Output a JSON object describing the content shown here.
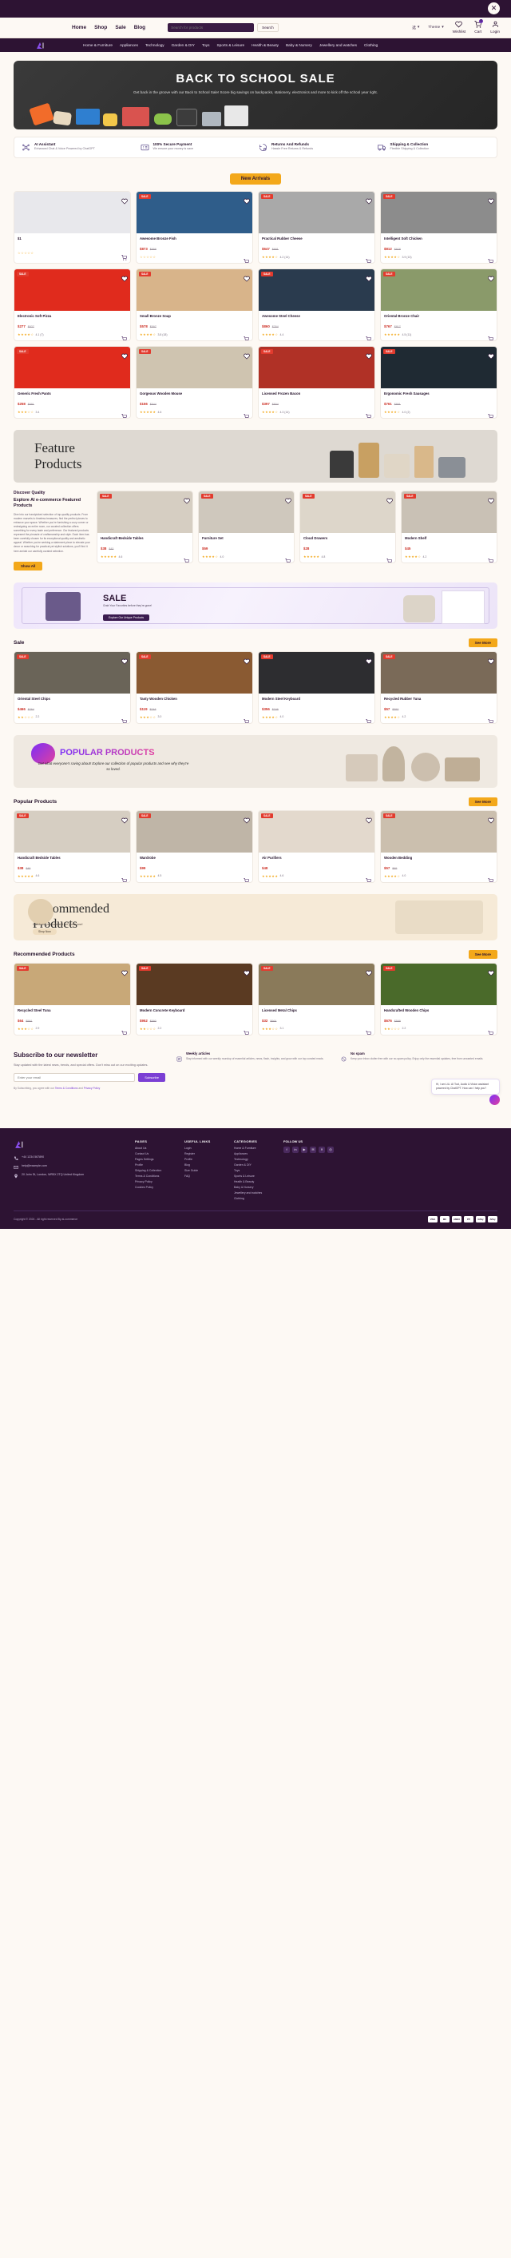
{
  "topbar": {
    "close_label": "✕"
  },
  "nav": {
    "links": [
      "Home",
      "Shop",
      "Sale",
      "Blog"
    ],
    "search_placeholder": "Search for products",
    "search_button": "Search",
    "language": "选",
    "theme": "Theme",
    "wishlist": "Wishlist",
    "cart": "Cart",
    "cart_count": "0",
    "login": "Login"
  },
  "categories": [
    "Home & Furniture",
    "Appliances",
    "Technology",
    "Garden & DIY",
    "Toys",
    "Sports & Leisure",
    "Health & Beauty",
    "Baby & Nursery",
    "Jewellery and watches",
    "Clothing"
  ],
  "hero": {
    "title": "BACK TO SCHOOL SALE",
    "subtitle": "Get back in the groove with our Back to School Sale! Score big savings on backpacks, stationery, electronics and more to kick off the school year right."
  },
  "features": [
    {
      "icon": "ai-assistant-icon",
      "title": "AI Assistant",
      "desc": "Enhanced Chat & Voice Powered by ChatGPT"
    },
    {
      "icon": "secure-payment-icon",
      "title": "100% Secure Payment",
      "desc": "We ensure your money is save"
    },
    {
      "icon": "returns-icon",
      "title": "Returns And Refunds",
      "desc": "Hassle Free Returns & Refunds"
    },
    {
      "icon": "shipping-icon",
      "title": "Shipping & Collection",
      "desc": "Flexible Shipping & Collection"
    }
  ],
  "new_arrivals": {
    "pill": "New Arrivals",
    "products": [
      {
        "name": "$1",
        "price": "",
        "old": "",
        "rating": "",
        "count": "",
        "sale": "",
        "img": "#e8e8ec"
      },
      {
        "name": "Awesome Bronze Fish",
        "price": "$873",
        "old": "$898",
        "rating": "",
        "count": "",
        "sale": "SALE",
        "img": "#2f5d8a"
      },
      {
        "name": "Practical Rubber Cheese",
        "price": "$647",
        "old": "$691",
        "rating": "4.2",
        "count": "14",
        "sale": "SALE",
        "img": "#a9a9a9"
      },
      {
        "name": "Intelligent Soft Chicken",
        "price": "$812",
        "old": "$978",
        "rating": "3.9",
        "count": "13",
        "sale": "SALE",
        "img": "#8c8c8c"
      },
      {
        "name": "Electronic Soft Pizza",
        "price": "$277",
        "old": "$827",
        "rating": "4.1",
        "count": "7",
        "sale": "SALE",
        "img": "#e02b1d"
      },
      {
        "name": "Small Bronze Soap",
        "price": "$578",
        "old": "$597",
        "rating": "3.8",
        "count": "18",
        "sale": "SALE",
        "img": "#d8b48a"
      },
      {
        "name": "Awesome Steel Cheese",
        "price": "$860",
        "old": "$764",
        "rating": "4.4",
        "count": "",
        "sale": "SALE",
        "img": "#2a3b4e"
      },
      {
        "name": "Oriental Bronze Chair",
        "price": "$767",
        "old": "$817",
        "rating": "4.5",
        "count": "11",
        "sale": "SALE",
        "img": "#8a9a6a"
      },
      {
        "name": "Generic Fresh Pants",
        "price": "$258",
        "old": "$591",
        "rating": "3.4",
        "count": "",
        "sale": "SALE",
        "img": "#e02b1d"
      },
      {
        "name": "Gorgeous Wooden Mouse",
        "price": "$156",
        "old": "$544",
        "rating": "4.6",
        "count": "",
        "sale": "SALE",
        "img": "#cfc4b0"
      },
      {
        "name": "Licensed Frozen Bacon",
        "price": "$397",
        "old": "$504",
        "rating": "4.3",
        "count": "14",
        "sale": "SALE",
        "img": "#b03126"
      },
      {
        "name": "Ergonomic Fresh Sausages",
        "price": "$761",
        "old": "$851",
        "rating": "4.0",
        "count": "2",
        "sale": "SALE",
        "img": "#1f2a33"
      }
    ]
  },
  "feature_banner": {
    "line1": "Feature",
    "line2": "Products"
  },
  "discover": {
    "eyebrow": "Discover Quality",
    "title": "Explore AI e-commerce Featured Products",
    "body": "Dive into our handpicked selection of top-quality products. From modern marvels to timeless treasures, find the perfect pieces to enhance your space. Whether you're furnishing a cozy corner or redesigning an entire room, our curated collection offers something for every taste and preference. Our featured products represent the pinnacle of craftsmanship and style. Each item has been carefully chosen for its exceptional quality and aesthetic appeal. Whether you're seeking a statement piece to elevate your decor or searching for practical yet stylish solutions, you'll find it here amidst our carefully curated selection.",
    "button": "Show All",
    "products": [
      {
        "name": "Handicraft Bedside Tables",
        "price": "$38",
        "old": "$45",
        "rating": "4.6",
        "count": "",
        "sale": "SALE",
        "img": "#d6cec2"
      },
      {
        "name": "Furniture Set",
        "price": "$59",
        "old": "",
        "rating": "4.0",
        "count": "",
        "sale": "SALE",
        "img": "#cfc8bd"
      },
      {
        "name": "Cloud Drawers",
        "price": "$28",
        "old": "",
        "rating": "4.8",
        "count": "",
        "sale": "SALE",
        "img": "#ddd6ca"
      },
      {
        "name": "Modern Shelf",
        "price": "$45",
        "old": "",
        "rating": "4.2",
        "count": "",
        "sale": "SALE",
        "img": "#c9c1b5"
      }
    ]
  },
  "sale_banner": {
    "word": "SALE",
    "text": "Grab Your Favorites before they're gone!",
    "button": "Explore Our Unique Products"
  },
  "sale_section": {
    "title": "Sale",
    "see_more": "See More",
    "products": [
      {
        "name": "Oriental Steel Chips",
        "price": "$466",
        "old": "$764",
        "rating": "2.2",
        "count": "",
        "sale": "SALE",
        "img": "#6a6458"
      },
      {
        "name": "Tasty Wooden Chicken",
        "price": "$119",
        "old": "$748",
        "rating": "3.0",
        "count": "",
        "sale": "SALE",
        "img": "#8a5a32"
      },
      {
        "name": "Modern Steel Keyboard",
        "price": "$356",
        "old": "$746",
        "rating": "4.0",
        "count": "",
        "sale": "SALE",
        "img": "#2d2d30"
      },
      {
        "name": "Recycled Rubber Tuna",
        "price": "$57",
        "old": "$352",
        "rating": "4.2",
        "count": "",
        "sale": "SALE",
        "img": "#7a6a58"
      }
    ]
  },
  "popular_banner": {
    "title": "POPULAR PRODUCTS",
    "subtitle": "Get what everyone's raving about! Explore our collection of popular products and see why they're so loved."
  },
  "popular_section": {
    "title": "Popular Products",
    "see_more": "See More",
    "products": [
      {
        "name": "Handicraft Bedside Tables",
        "price": "$38",
        "old": "$45",
        "rating": "4.6",
        "count": "",
        "sale": "SALE",
        "img": "#d6cec2"
      },
      {
        "name": "Wardrobe",
        "price": "$99",
        "old": "",
        "rating": "4.5",
        "count": "",
        "sale": "SALE",
        "img": "#bfb5a7"
      },
      {
        "name": "Air Purifiers",
        "price": "$48",
        "old": "",
        "rating": "4.6",
        "count": "",
        "sale": "SALE",
        "img": "#e3d9cd"
      },
      {
        "name": "Wooden Bedding",
        "price": "$57",
        "old": "$65",
        "rating": "4.0",
        "count": "",
        "sale": "SALE",
        "img": "#cbbfae"
      }
    ]
  },
  "recommended_banner": {
    "line1": "Recommended",
    "line2": "Products",
    "subtitle": "Check our products and get yours now!",
    "button": "Shop Now"
  },
  "recommended_section": {
    "title": "Recommended Products",
    "see_more": "See More",
    "products": [
      {
        "name": "Recycled Steel Tuna",
        "price": "$64",
        "old": "$591",
        "rating": "2.9",
        "count": "",
        "sale": "SALE",
        "img": "#c8a878"
      },
      {
        "name": "Modern Concrete Keyboard",
        "price": "$952",
        "old": "$590",
        "rating": "2.2",
        "count": "",
        "sale": "SALE",
        "img": "#5a3a22"
      },
      {
        "name": "Licensed Metal Chips",
        "price": "$32",
        "old": "$664",
        "rating": "3.1",
        "count": "",
        "sale": "SALE",
        "img": "#8a7a5a"
      },
      {
        "name": "Handcrafted Wooden Chips",
        "price": "$676",
        "old": "$599",
        "rating": "2.2",
        "count": "",
        "sale": "SALE",
        "img": "#4a6a2a"
      }
    ]
  },
  "newsletter": {
    "title": "Subscribe to our newsletter",
    "body": "Stay updated with the latest news, trends, and special offers. Don't miss out on our exciting updates.",
    "placeholder": "Enter your email",
    "button": "Subscribe",
    "note_prefix": "By Subscribing, you agree with our ",
    "note_link1": "Terms & Conditions",
    "note_and": " and ",
    "note_link2": "Privacy Policy",
    "perks": [
      {
        "icon": "article-icon",
        "title": "Weekly articles",
        "desc": "Stay informed with our weekly roundup of essential articles, news, flash, insights, and grow with our top curated reads."
      },
      {
        "icon": "nospam-icon",
        "title": "No spam",
        "desc": "Keep your inbox clutter free with our no-spam policy. Enjoy only the essential updates, free from unwanted emails."
      }
    ]
  },
  "chat": {
    "message": "Hi, I am LiLi. AI Tool, Audio & Vision assistant powered by ChatGPT. How can I help you?"
  },
  "footer": {
    "contact": [
      {
        "icon": "phone-icon",
        "text": "+44 1234 567890"
      },
      {
        "icon": "mail-icon",
        "text": "help@example.com"
      },
      {
        "icon": "pin-icon",
        "text": "20 John St, London, WR5X 2TQ United Kingdom"
      }
    ],
    "columns": [
      {
        "heading": "PAGES",
        "links": [
          "About Us",
          "Contact Us",
          "Pages Settings",
          "Profile",
          "Shipping & Collection",
          "Terms & Conditions",
          "Privacy Policy",
          "Cookies Policy"
        ]
      },
      {
        "heading": "USEFUL LINKS",
        "links": [
          "Login",
          "Register",
          "Profile",
          "Blog",
          "Size Guide",
          "FAQ"
        ]
      },
      {
        "heading": "CATEGORIES",
        "links": [
          "Home & Furniture",
          "Appliances",
          "Technology",
          "Garden & DIY",
          "Toys",
          "Sports & Leisure",
          "Health & Beauty",
          "Baby & Nursery",
          "Jewellery and watches",
          "Clothing"
        ]
      }
    ],
    "social_heading": "FOLLOW US",
    "socials": [
      "f",
      "in",
      "▶",
      "✉",
      "✕",
      "◎"
    ],
    "copyright": "Copyright © 2024 - All right reserved By ai-commerce",
    "payments": [
      "VISA",
      "MC",
      "AMEX",
      "PP",
      "GPay",
      "APay"
    ]
  }
}
